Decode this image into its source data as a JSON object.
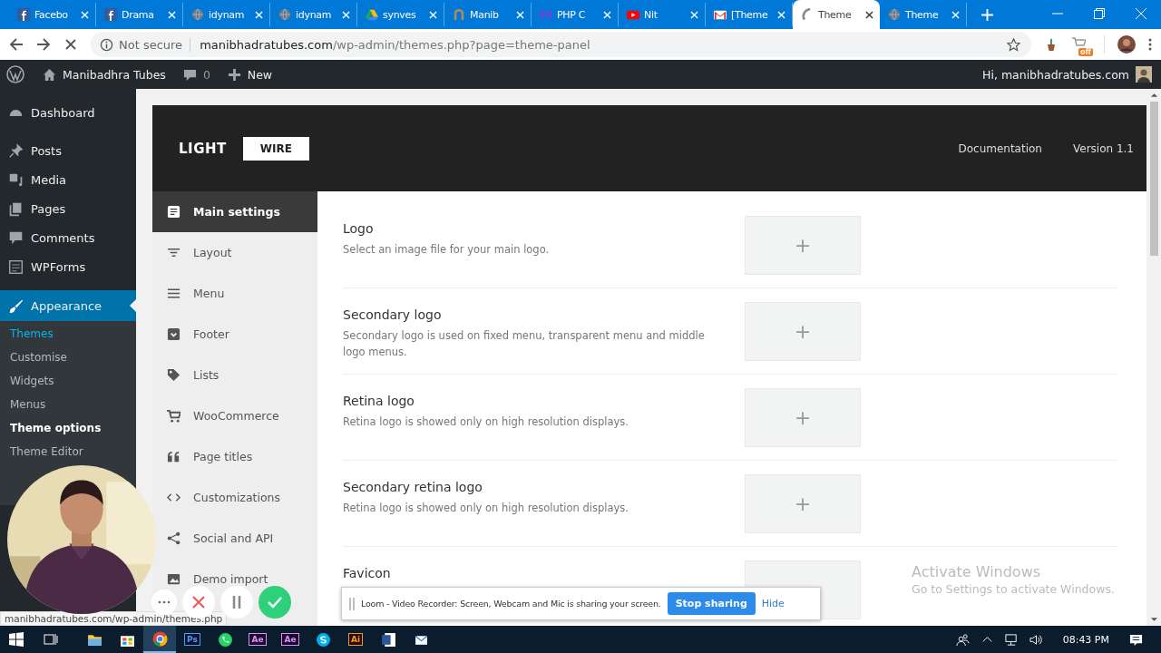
{
  "browser": {
    "tabs": [
      {
        "title": "Facebo",
        "selected": false
      },
      {
        "title": "Drama",
        "selected": false
      },
      {
        "title": "idynam",
        "selected": false
      },
      {
        "title": "idynam",
        "selected": false
      },
      {
        "title": "synves",
        "selected": false
      },
      {
        "title": "Manib",
        "selected": false
      },
      {
        "title": "PHP C",
        "selected": false
      },
      {
        "title": "Nit",
        "selected": false
      },
      {
        "title": "[Theme",
        "selected": false
      },
      {
        "title": "Theme",
        "selected": true
      },
      {
        "title": "Theme",
        "selected": false
      }
    ],
    "security": "Not secure",
    "url_host": "manibhadratubes.com",
    "url_path": "/wp-admin/themes.php?page=theme-panel",
    "extension_badge": "off",
    "status_url": "manibhadratubes.com/wp-admin/themes.php"
  },
  "admin_bar": {
    "site": "Manibadhra Tubes",
    "comments": "0",
    "new": "New",
    "greeting": "Hi, manibhadratubes.com"
  },
  "sidebar": {
    "items": [
      {
        "label": "Dashboard",
        "selected": false
      },
      {
        "label": "Posts",
        "selected": false
      },
      {
        "label": "Media",
        "selected": false
      },
      {
        "label": "Pages",
        "selected": false
      },
      {
        "label": "Comments",
        "selected": false
      },
      {
        "label": "WPForms",
        "selected": false
      },
      {
        "label": "Appearance",
        "selected": true
      }
    ],
    "submenu": [
      {
        "label": "Themes",
        "selected": false,
        "hovered": true
      },
      {
        "label": "Customise",
        "selected": false,
        "hovered": false
      },
      {
        "label": "Widgets",
        "selected": false,
        "hovered": false
      },
      {
        "label": "Menus",
        "selected": false,
        "hovered": false
      },
      {
        "label": "Theme options",
        "selected": true,
        "hovered": false
      },
      {
        "label": "Theme Editor",
        "selected": false,
        "hovered": false
      }
    ]
  },
  "panel": {
    "brand": "LIGHT",
    "brand_box": "WIRE",
    "documentation": "Documentation",
    "version": "Version 1.1",
    "nav": [
      {
        "label": "Main settings",
        "selected": true
      },
      {
        "label": "Layout",
        "selected": false
      },
      {
        "label": "Menu",
        "selected": false
      },
      {
        "label": "Footer",
        "selected": false
      },
      {
        "label": "Lists",
        "selected": false
      },
      {
        "label": "WooCommerce",
        "selected": false
      },
      {
        "label": "Page titles",
        "selected": false
      },
      {
        "label": "Customizations",
        "selected": false
      },
      {
        "label": "Social and API",
        "selected": false
      },
      {
        "label": "Demo import",
        "selected": false
      }
    ],
    "settings": [
      {
        "title": "Logo",
        "description": "Select an image file for your main logo.",
        "upload": "+"
      },
      {
        "title": "Secondary logo",
        "description": "Secondary logo is used on fixed menu, transparent menu and middle logo menus.",
        "upload": "+"
      },
      {
        "title": "Retina logo",
        "description": "Retina logo is showed only on high resolution displays.",
        "upload": "+"
      },
      {
        "title": "Secondary retina logo",
        "description": "Retina logo is showed only on high resolution displays.",
        "upload": "+"
      },
      {
        "title": "Favicon"
      }
    ]
  },
  "recorder": {
    "message": "Loom - Video Recorder: Screen, Webcam and Mic is sharing your screen.",
    "stop": "Stop sharing",
    "hide": "Hide"
  },
  "activation": {
    "title": "Activate Windows",
    "message": "Go to Settings to activate Windows."
  },
  "taskbar": {
    "apps": [
      {
        "active": false
      },
      {
        "active": false
      },
      {
        "active": true
      },
      {
        "label": "Ps",
        "color": "#31a8ff",
        "active": false
      },
      {
        "active": false
      },
      {
        "label": "Ae",
        "color": "#d291ff",
        "active": false
      },
      {
        "label": "Ae",
        "color": "#d291ff",
        "active": false
      },
      {
        "active": false
      },
      {
        "label": "Ai",
        "color": "#ff9a00",
        "active": false
      },
      {
        "active": false
      },
      {
        "active": false
      }
    ],
    "clock": "08:43 PM"
  }
}
